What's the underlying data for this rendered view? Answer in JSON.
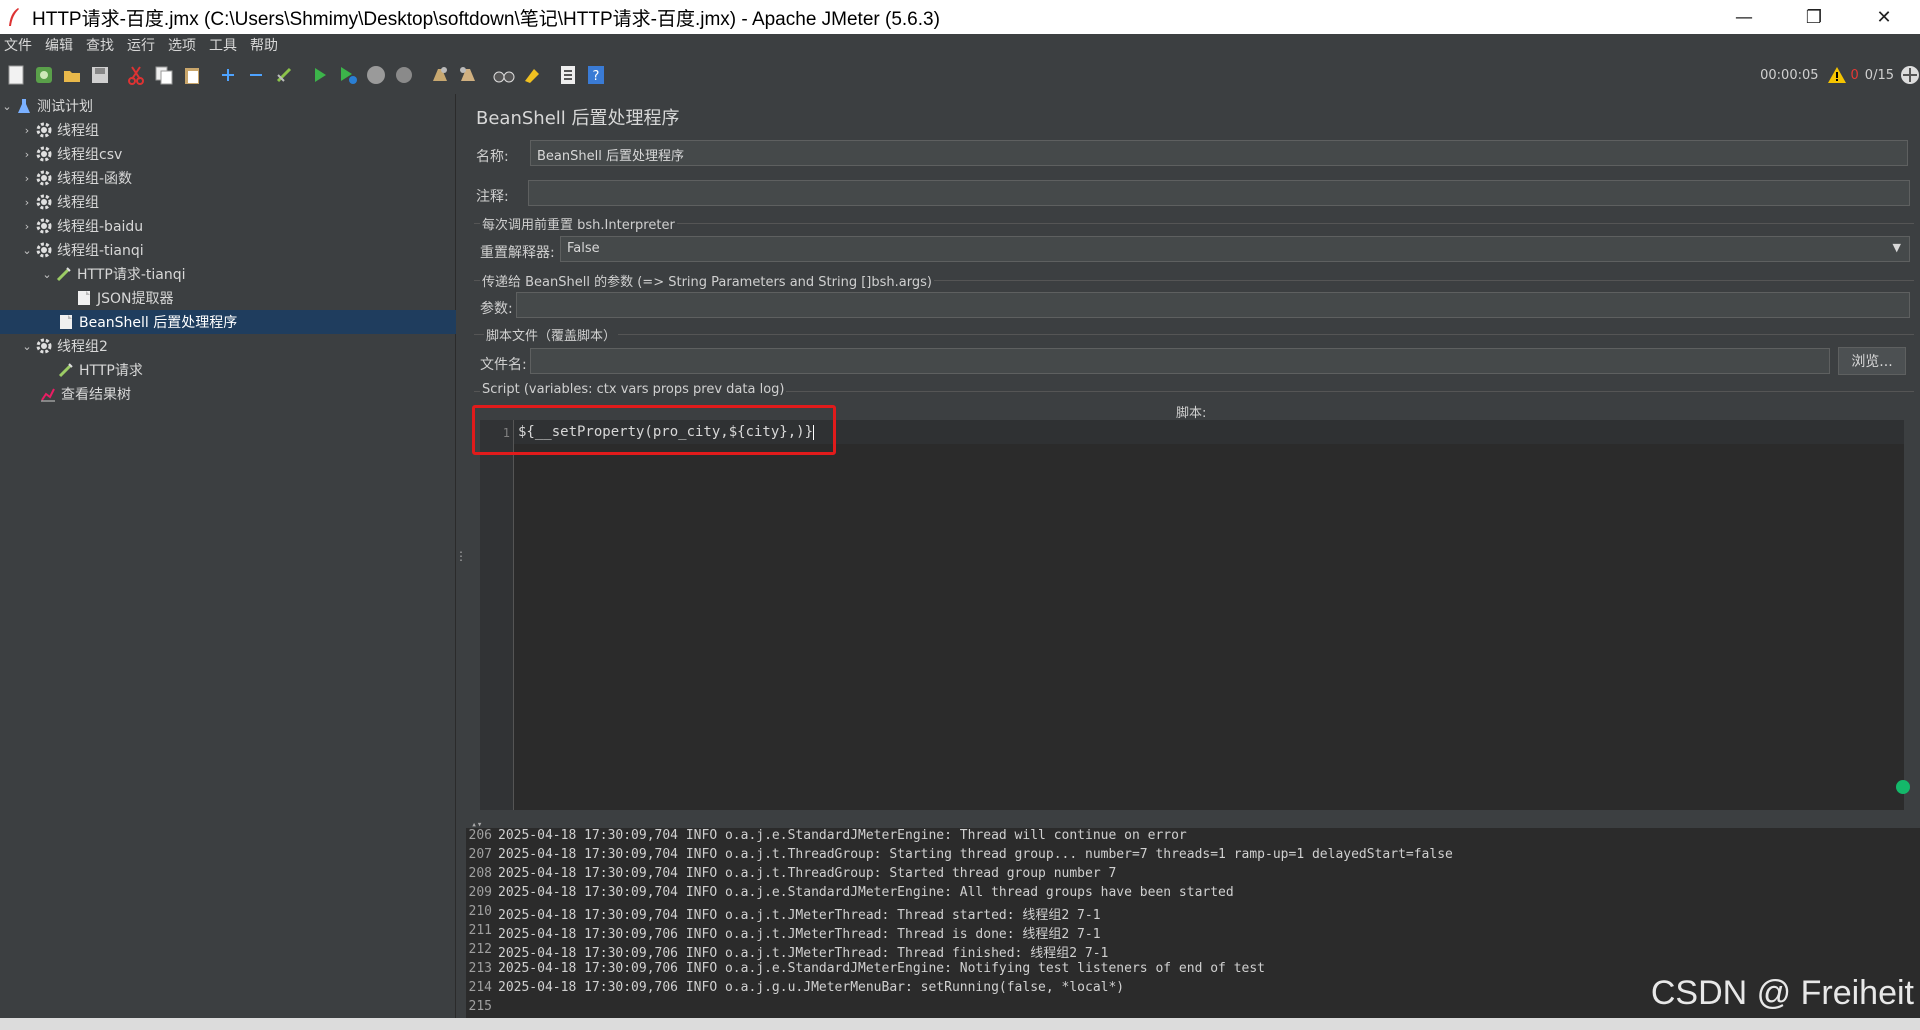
{
  "window": {
    "title": "HTTP请求-百度.jmx (C:\\Users\\Shmimy\\Desktop\\softdown\\笔记\\HTTP请求-百度.jmx) - Apache JMeter (5.6.3)",
    "minimize": "—",
    "restore": "❐",
    "close": "✕"
  },
  "menu": [
    "文件",
    "编辑",
    "查找",
    "运行",
    "选项",
    "工具",
    "帮助"
  ],
  "status": {
    "timer": "00:00:05",
    "warnings": "0",
    "threads": "0/15"
  },
  "tree": {
    "items": [
      {
        "label": "测试计划",
        "icon": "flask-icon"
      },
      {
        "label": "线程组",
        "icon": "gear-icon"
      },
      {
        "label": "线程组csv",
        "icon": "gear-icon"
      },
      {
        "label": "线程组-函数",
        "icon": "gear-icon"
      },
      {
        "label": "线程组",
        "icon": "gear-icon"
      },
      {
        "label": "线程组-baidu",
        "icon": "gear-icon"
      },
      {
        "label": "线程组-tianqi",
        "icon": "gear-icon"
      },
      {
        "label": "HTTP请求-tianqi",
        "icon": "pencil-icon"
      },
      {
        "label": "JSON提取器",
        "icon": "document-icon"
      },
      {
        "label": "BeanShell 后置处理程序",
        "icon": "document-icon"
      },
      {
        "label": "线程组2",
        "icon": "gear-icon"
      },
      {
        "label": "HTTP请求",
        "icon": "pencil-icon"
      },
      {
        "label": "查看结果树",
        "icon": "chart-icon"
      }
    ]
  },
  "panel": {
    "title": "BeanShell 后置处理程序",
    "name_label": "名称:",
    "name_value": "BeanShell 后置处理程序",
    "comment_label": "注释:",
    "comment_value": "",
    "reset_group": "每次调用前重置 bsh.Interpreter",
    "reset_label": "重置解释器:",
    "reset_value": "False",
    "params_group": "传递给 BeanShell 的参数 (=> String Parameters and String []bsh.args)",
    "params_label": "参数:",
    "params_value": "",
    "file_group": "脚本文件（覆盖脚本）",
    "file_label": "文件名:",
    "file_value": "",
    "browse": "浏览...",
    "script_group": "Script (variables: ctx vars props prev data log)",
    "script_label": "脚本:"
  },
  "editor": {
    "line_number": "1",
    "code": "${__setProperty(pro_city,${city},)}"
  },
  "log": [
    {
      "n": "206",
      "text": "2025-04-18 17:30:09,704 INFO o.a.j.e.StandardJMeterEngine: Thread will continue on error"
    },
    {
      "n": "207",
      "text": "2025-04-18 17:30:09,704 INFO o.a.j.t.ThreadGroup: Starting thread group... number=7 threads=1 ramp-up=1 delayedStart=false"
    },
    {
      "n": "208",
      "text": "2025-04-18 17:30:09,704 INFO o.a.j.t.ThreadGroup: Started thread group number 7"
    },
    {
      "n": "209",
      "text": "2025-04-18 17:30:09,704 INFO o.a.j.e.StandardJMeterEngine: All thread groups have been started"
    },
    {
      "n": "210",
      "text": "2025-04-18 17:30:09,704 INFO o.a.j.t.JMeterThread: Thread started: 线程组2 7-1"
    },
    {
      "n": "211",
      "text": "2025-04-18 17:30:09,706 INFO o.a.j.t.JMeterThread: Thread is done: 线程组2 7-1"
    },
    {
      "n": "212",
      "text": "2025-04-18 17:30:09,706 INFO o.a.j.t.JMeterThread: Thread finished: 线程组2 7-1"
    },
    {
      "n": "213",
      "text": "2025-04-18 17:30:09,706 INFO o.a.j.e.StandardJMeterEngine: Notifying test listeners of end of test"
    },
    {
      "n": "214",
      "text": "2025-04-18 17:30:09,706 INFO o.a.j.g.u.JMeterMenuBar: setRunning(false, *local*)"
    },
    {
      "n": "215",
      "text": ""
    }
  ],
  "watermark": "CSDN @ Freiheit"
}
